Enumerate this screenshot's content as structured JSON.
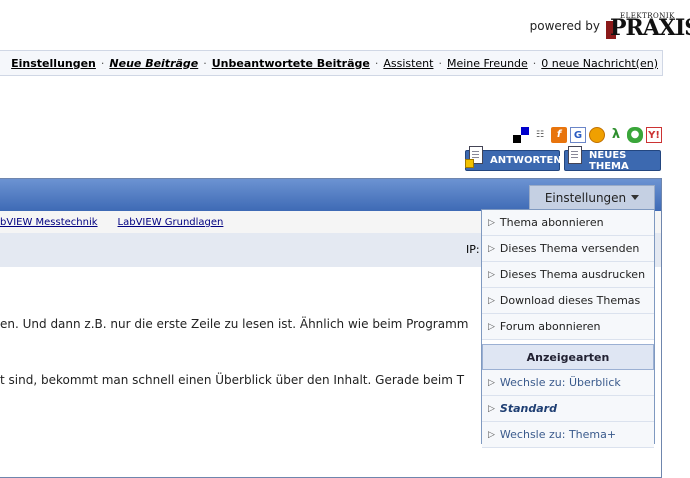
{
  "header": {
    "powered_by": "powered by",
    "logo_small": "ELEKTRONIK",
    "logo_big": "PRAXIS"
  },
  "navbar": {
    "items": [
      {
        "label": "Einstellungen"
      },
      {
        "label": "Neue Beiträge"
      },
      {
        "label": "Unbeantwortete Beiträge"
      },
      {
        "label": "Assistent"
      },
      {
        "label": "Meine Freunde"
      },
      {
        "label": "0 neue Nachricht(en)"
      }
    ]
  },
  "social": {
    "icons": [
      "delicious-icon",
      "mister-wong-icon",
      "furl-icon",
      "google-icon",
      "stumbleupon-icon",
      "technorati-icon",
      "live-icon",
      "yahoo-icon"
    ]
  },
  "buttons": {
    "reply": "ANTWORTEN",
    "new_topic": "NEUES THEMA"
  },
  "thread": {
    "settings_label": "Einstellungen",
    "breadcrumbs": [
      "bVIEW Messtechnik",
      "LabVIEW Grundlagen"
    ],
    "ip_label": "IP:",
    "line1": "en. Und dann z.B. nur die erste Zeile zu lesen ist. Ähnlich wie beim Programm",
    "line2": "t sind, bekommt man schnell einen Überblick über den Inhalt. Gerade beim T"
  },
  "menu": {
    "items": [
      "Thema abonnieren",
      "Dieses Thema versenden",
      "Dieses Thema ausdrucken",
      "Download dieses Themas",
      "Forum abonnieren"
    ],
    "section_title": "Anzeigearten",
    "view_items": [
      "Wechsle zu: Überblick",
      "Standard",
      "Wechsle zu: Thema+"
    ]
  },
  "colors": {
    "header_blue": "#3e6ab5",
    "link_blue": "#000080",
    "button_blue": "#3c69b0"
  }
}
